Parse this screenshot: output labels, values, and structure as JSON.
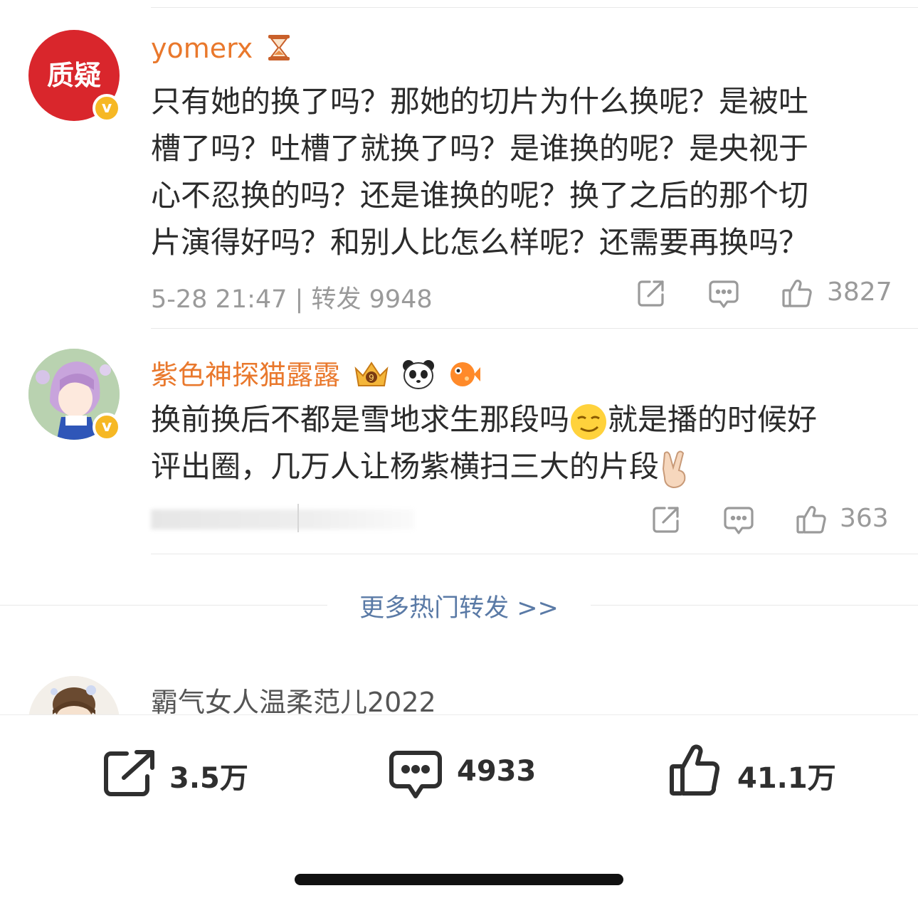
{
  "comments": [
    {
      "avatar_text": "质疑",
      "username": "yomerx",
      "username_badge": "hourglass-icon",
      "lines": [
        "只有她的换了吗？那她的切片为什么换呢？是被吐",
        "槽了吗？吐槽了就换了吗？是谁换的呢？是央视于",
        "心不忍换的吗？还是谁换的呢？换了之后的那个切",
        "片演得好吗？和别人比怎么样呢？还需要再换吗？"
      ],
      "meta": "5-28 21:47 | 转发 9948",
      "likes": "3827"
    },
    {
      "username": "紫色神探猫露露",
      "lines_1a": "换前换后不都是雪地求生那段吗",
      "lines_1b": "就是播的时候好",
      "lines_2": "评出圈，几万人让杨紫横扫三大的片段",
      "likes": "363"
    }
  ],
  "more_link": "更多热门转发 >>",
  "partial_comment": {
    "username": "霸气女人温柔范儿2022"
  },
  "bottom_bar": {
    "repost": "3.5万",
    "comments": "4933",
    "likes": "41.1万"
  },
  "colors": {
    "username": "#e9782c",
    "link": "#5a7aa6",
    "verified": "#f6b824",
    "avatar_red": "#d9262c"
  }
}
